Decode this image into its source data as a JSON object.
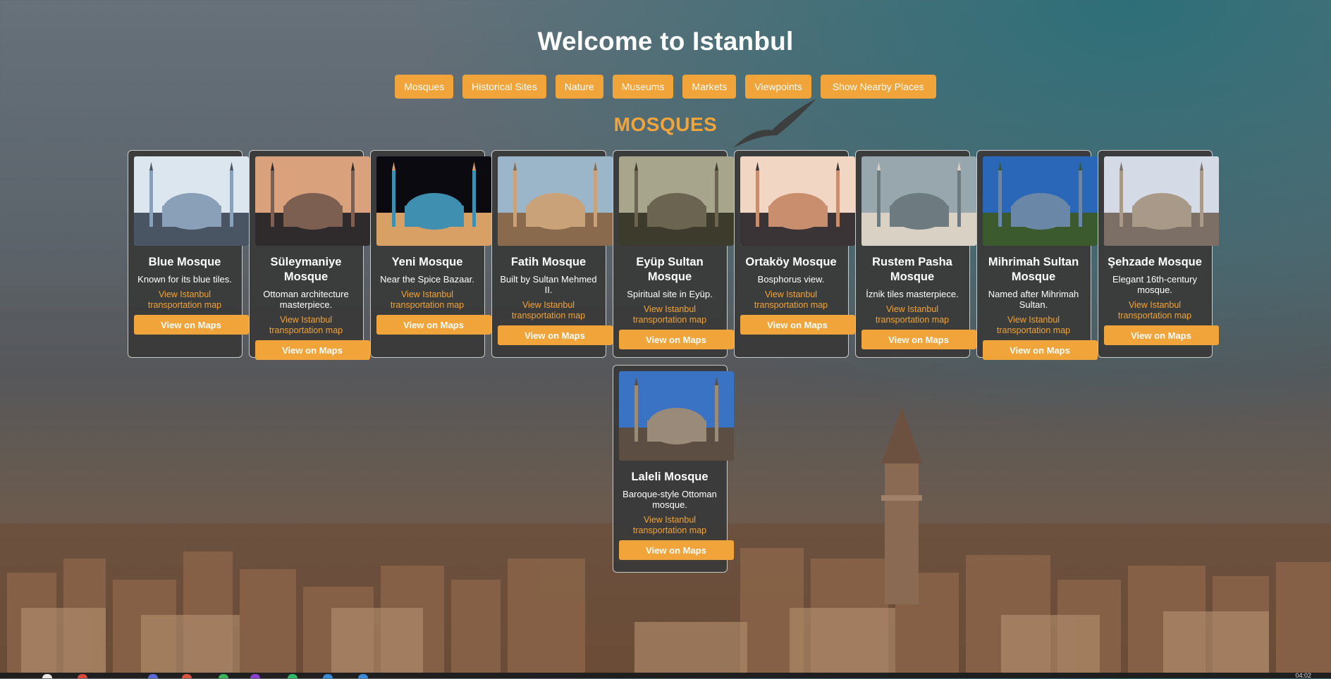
{
  "page": {
    "title": "Welcome to Istanbul"
  },
  "nav": {
    "buttons": [
      "Mosques",
      "Historical Sites",
      "Nature",
      "Museums",
      "Markets",
      "Viewpoints",
      "Show Nearby Places"
    ]
  },
  "section": {
    "heading": "MOSQUES"
  },
  "cards": [
    {
      "name": "Blue Mosque",
      "desc": "Known for its blue tiles.",
      "link": "View Istanbul transportation map",
      "button": "View on Maps",
      "colors": [
        "#dbe6ef",
        "#8aa0b8",
        "#4a5563"
      ]
    },
    {
      "name": "Süleymaniye Mosque",
      "desc": "Ottoman architecture masterpiece.",
      "link": "View Istanbul transportation map",
      "button": "View on Maps",
      "colors": [
        "#d9a27c",
        "#7d5f52",
        "#2f2a2c"
      ]
    },
    {
      "name": "Yeni Mosque",
      "desc": "Near the Spice Bazaar.",
      "link": "View Istanbul transportation map",
      "button": "View on Maps",
      "colors": [
        "#0b0a10",
        "#3e8fb0",
        "#d8a064"
      ]
    },
    {
      "name": "Fatih Mosque",
      "desc": "Built by Sultan Mehmed II.",
      "link": "View Istanbul transportation map",
      "button": "View on Maps",
      "colors": [
        "#9cb6c9",
        "#c9a27a",
        "#8a6a4c"
      ]
    },
    {
      "name": "Eyüp Sultan Mosque",
      "desc": "Spiritual site in Eyüp.",
      "link": "View Istanbul transportation map",
      "button": "View on Maps",
      "colors": [
        "#a7a58c",
        "#6b6450",
        "#3d3b2c"
      ]
    },
    {
      "name": "Ortaköy Mosque",
      "desc": "Bosphorus view.",
      "link": "View Istanbul transportation map",
      "button": "View on Maps",
      "colors": [
        "#f1d6c4",
        "#c98e6d",
        "#3a3436"
      ]
    },
    {
      "name": "Rustem Pasha Mosque",
      "desc": "İznik tiles masterpiece.",
      "link": "View Istanbul transportation map",
      "button": "View on Maps",
      "colors": [
        "#98a6ad",
        "#6d7b80",
        "#d9d2c4"
      ]
    },
    {
      "name": "Mihrimah Sultan Mosque",
      "desc": "Named after Mihrimah Sultan.",
      "link": "View Istanbul transportation map",
      "button": "View on Maps",
      "colors": [
        "#2a67b8",
        "#6b87a8",
        "#3b5a2e"
      ]
    },
    {
      "name": "Şehzade Mosque",
      "desc": "Elegant 16th-century mosque.",
      "link": "View Istanbul transportation map",
      "button": "View on Maps",
      "colors": [
        "#d4dbe6",
        "#a99988",
        "#7b6f66"
      ]
    },
    {
      "name": "Laleli Mosque",
      "desc": "Baroque-style Ottoman mosque.",
      "link": "View Istanbul transportation map",
      "button": "View on Maps",
      "colors": [
        "#3a73c4",
        "#9a8a7a",
        "#5d4e44"
      ]
    }
  ],
  "taskbar": {
    "clock": "04:02"
  },
  "theme": {
    "accent": "#f0a43a",
    "card_bg": "#3a3a3a"
  }
}
